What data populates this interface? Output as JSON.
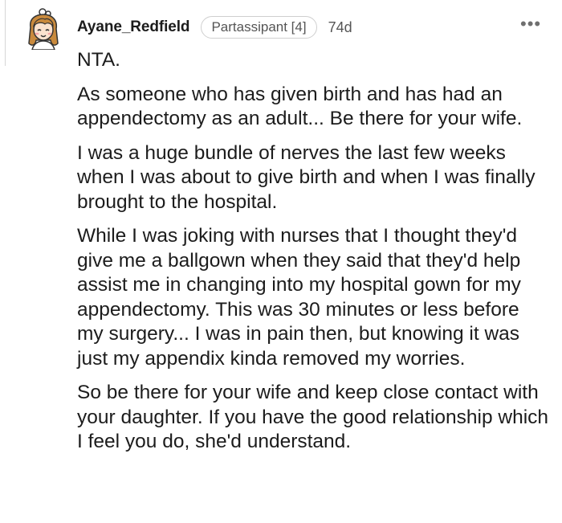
{
  "comment": {
    "author": "Ayane_Redfield",
    "flair": "Partassipant [4]",
    "age": "74d",
    "more_label": "•••",
    "paragraphs": [
      "NTA.",
      "As someone who has given birth and has had an appendectomy as an adult... Be there for your wife.",
      "I was a huge bundle of nerves the last few weeks when I was about to give birth and when I was finally brought to the hospital.",
      "While I was joking with nurses that I thought they'd give me a ballgown when they said that they'd help assist me in changing into my hospital gown for my appendectomy. This was 30 minutes or less before my surgery... I was in pain then, but knowing it was just my appendix kinda removed my worries.",
      "So be there for your wife and keep close contact with your daughter. If you have the good relationship which I feel you do, she'd understand."
    ]
  },
  "colors": {
    "text": "#1c1c1c",
    "meta": "#555555",
    "flair_border": "#cfcfcf",
    "thread_line": "#d6d6d6",
    "avatar_hair": "#c98a3d"
  }
}
